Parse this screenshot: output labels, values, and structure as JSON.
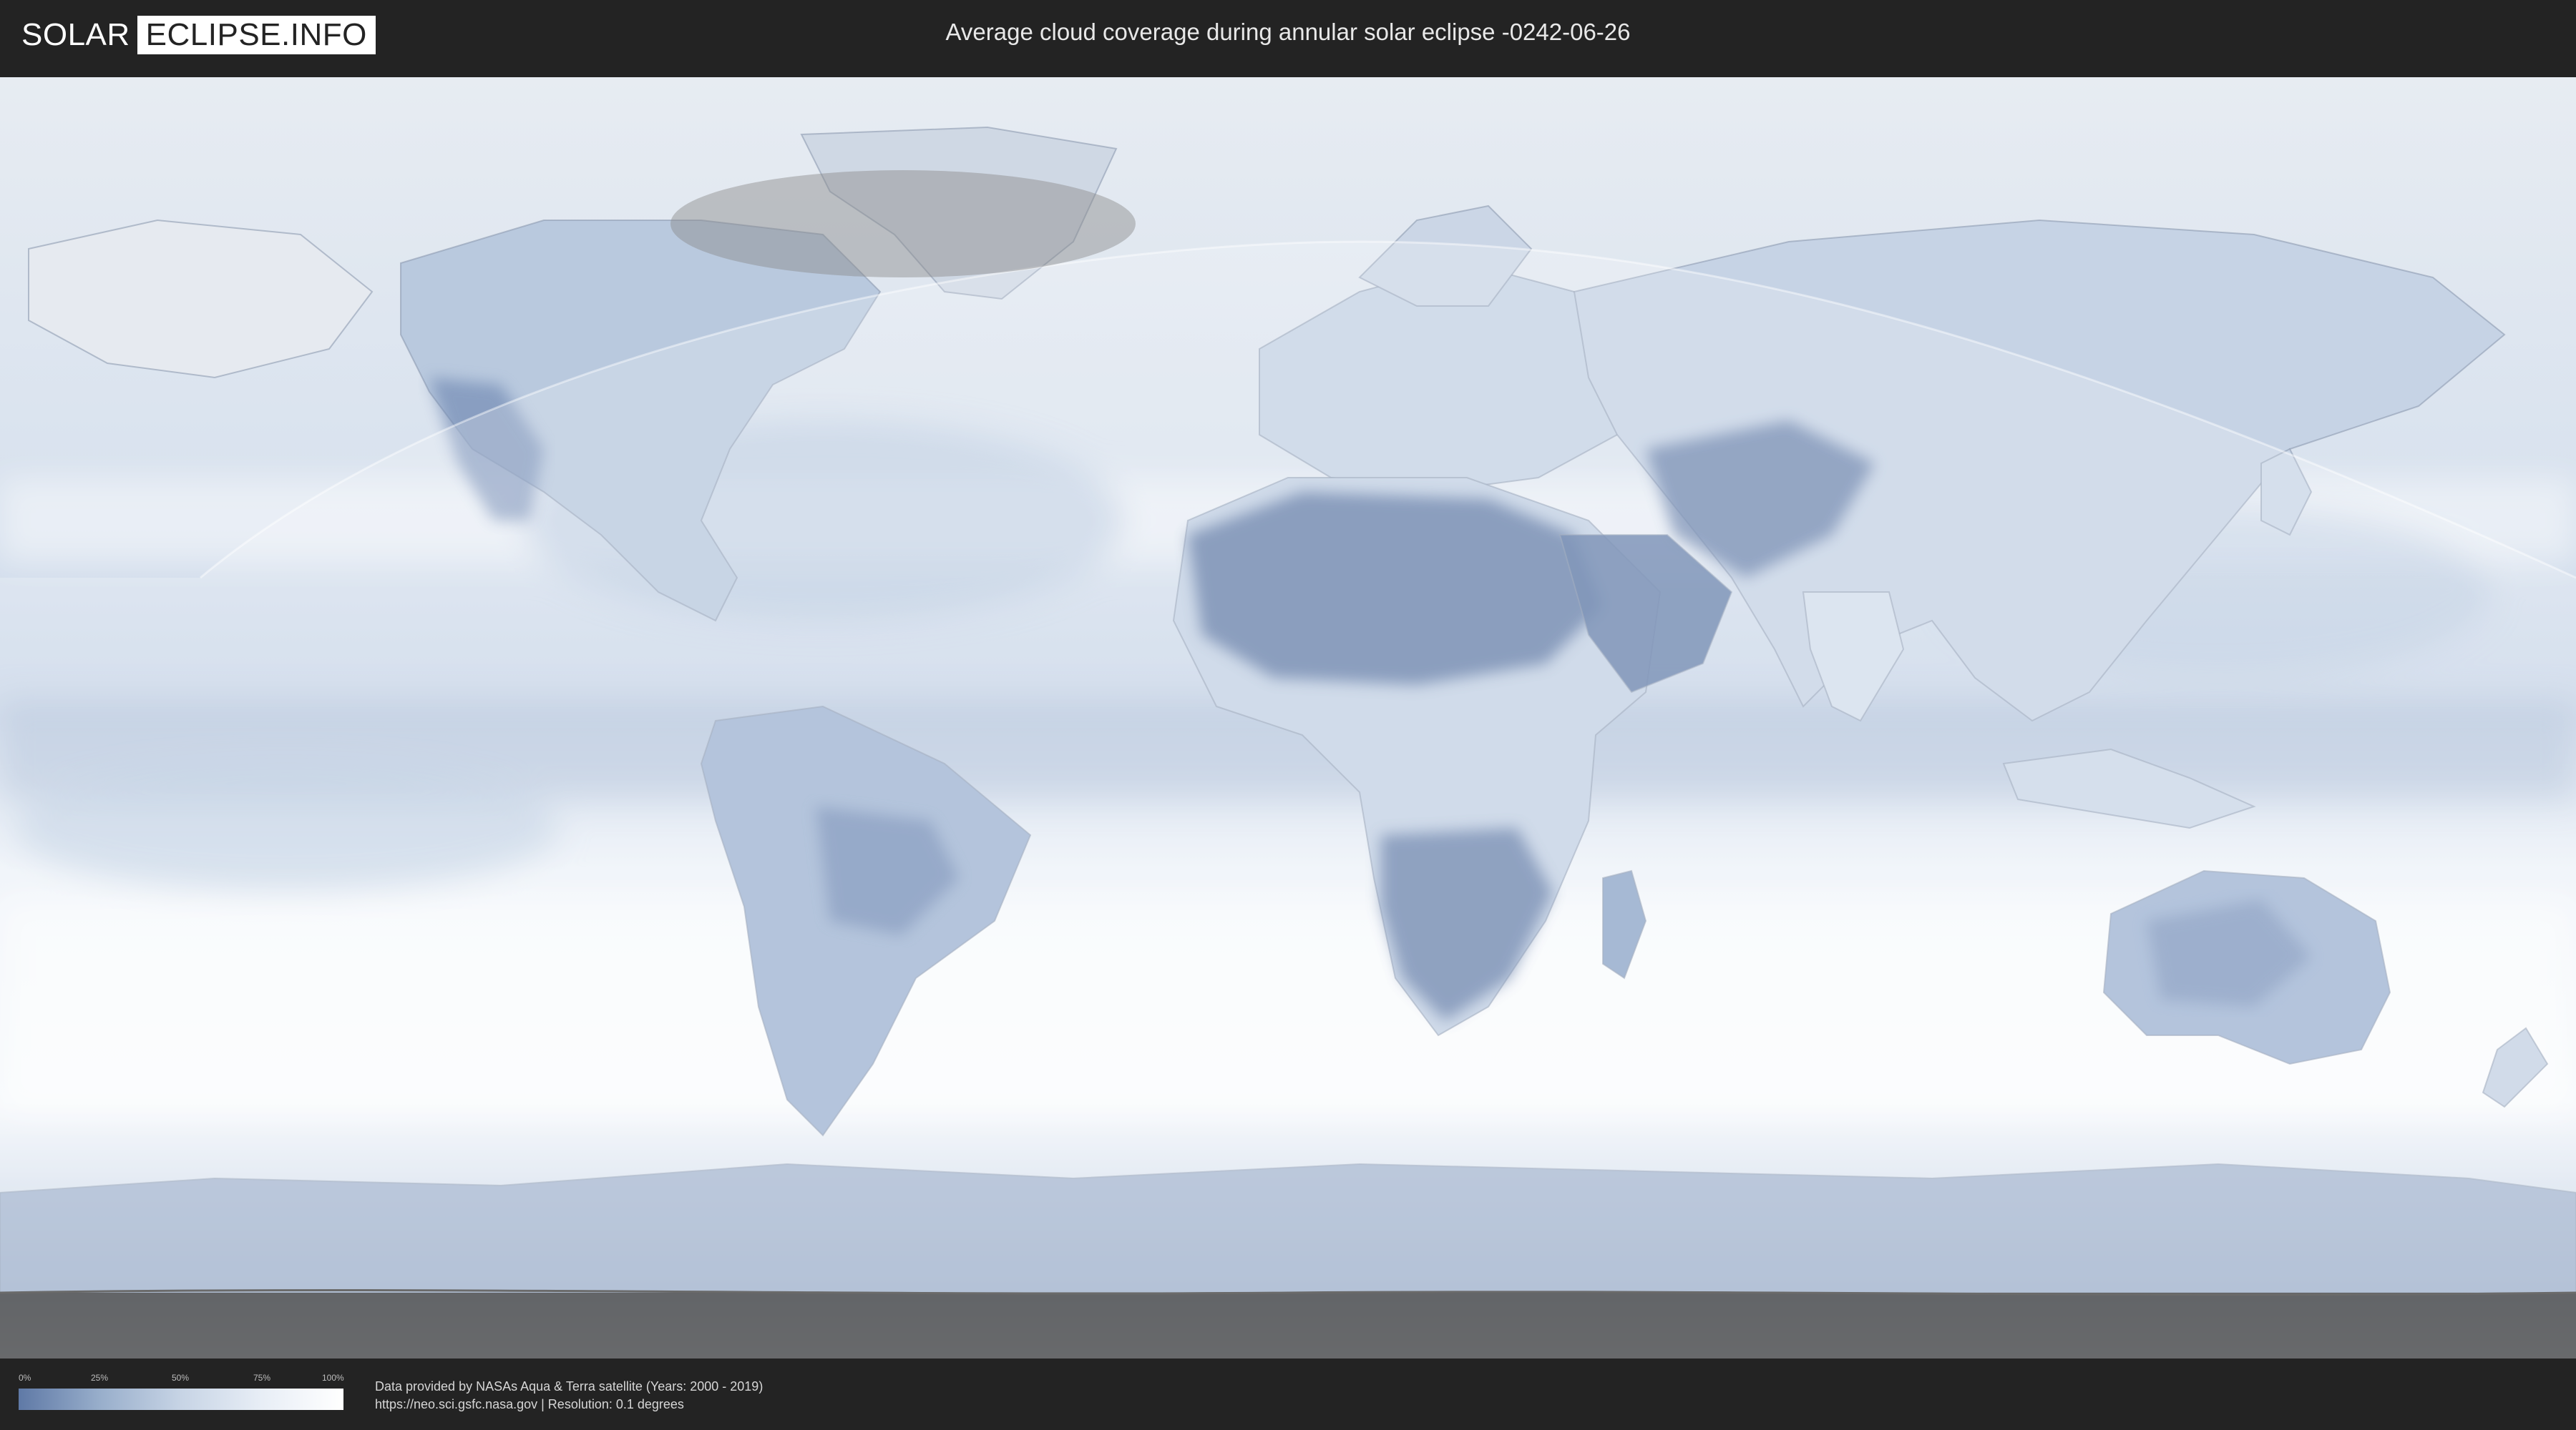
{
  "header": {
    "logo_left": "SOLAR",
    "logo_right": "ECLIPSE.INFO",
    "title": "Average cloud coverage during annular solar eclipse -0242-06-26"
  },
  "legend": {
    "ticks": [
      "0%",
      "25%",
      "50%",
      "75%",
      "100%"
    ],
    "colors": [
      "#5f79a6",
      "#98aecb",
      "#c7d4e5",
      "#e8eef6",
      "#ffffff"
    ]
  },
  "credits": {
    "line1": "Data provided by NASAs Aqua & Terra satellite (Years: 2000 - 2019)",
    "line2": "https://neo.sci.gsfc.nasa.gov | Resolution: 0.1 degrees"
  },
  "map": {
    "base_color": "#eaf0f7",
    "land_dark_color": "#5b76a3",
    "shadow_color": "#8a8a8a",
    "icons": {
      "eclipse_zone": "translucent-dome",
      "shadow_overlay": "grey-band"
    }
  }
}
